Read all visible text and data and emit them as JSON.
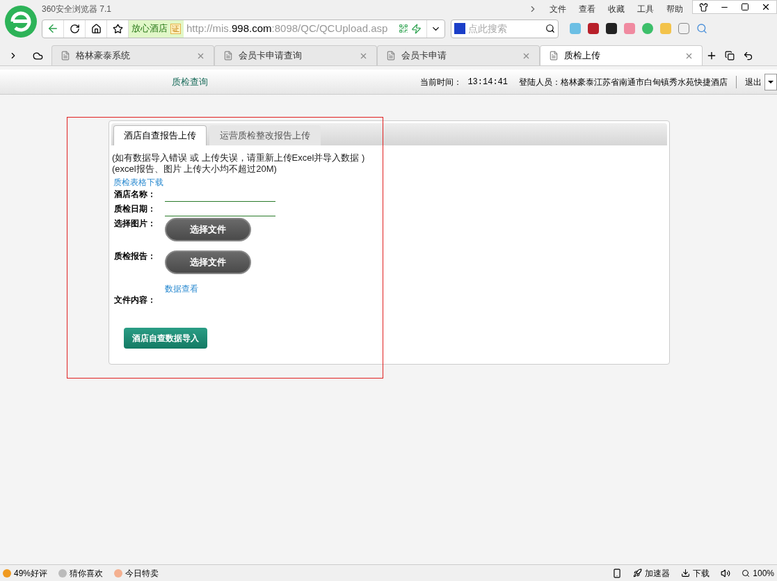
{
  "browser": {
    "title": "360安全浏览器 7.1",
    "menu": [
      "文件",
      "查看",
      "收藏",
      "工具",
      "帮助"
    ],
    "address": {
      "site_badge": "放心酒店",
      "cert": "证",
      "url_prefix": "http://mis.",
      "url_host": "998.com",
      "url_suffix": ":8098/QC/QCUpload.asp"
    },
    "search": {
      "placeholder": "点此搜索"
    },
    "tabs": [
      {
        "label": "格林豪泰系统",
        "selected": false
      },
      {
        "label": "会员卡申请查询",
        "selected": false
      },
      {
        "label": "会员卡申请",
        "selected": false
      },
      {
        "label": "质检上传",
        "selected": true
      }
    ]
  },
  "page": {
    "nav_link": "质检查询",
    "time_label": "当前时间：",
    "time": "13:14:41",
    "user_label": "登陆人员：",
    "user": "格林豪泰江苏省南通市白甸镇秀水苑快捷酒店",
    "logout": "退出"
  },
  "card": {
    "tabs": [
      {
        "label": "酒店自查报告上传",
        "selected": true
      },
      {
        "label": "运营质检整改报告上传",
        "selected": false
      }
    ],
    "notes": [
      "(如有数据导入错误 或 上传失误，请重新上传Excel并导入数据 )",
      "(excel报告、图片 上传大小均不超过20M)"
    ],
    "download_link": "质检表格下载",
    "fields": [
      {
        "kind": "input",
        "label": "酒店名称："
      },
      {
        "kind": "input",
        "label": "质检日期："
      },
      {
        "kind": "file",
        "label": "选择图片：",
        "button": "选择文件"
      },
      {
        "kind": "file",
        "label": "质检报告：",
        "button": "选择文件"
      }
    ],
    "view_link": "数据查看",
    "content_label": "文件内容：",
    "submit": "酒店自查数据导入"
  },
  "status_bar": {
    "items": [
      "49%好评",
      "猜你喜欢",
      "今日特卖"
    ],
    "right": [
      "加速器",
      "下载"
    ],
    "zoom": "100%"
  }
}
